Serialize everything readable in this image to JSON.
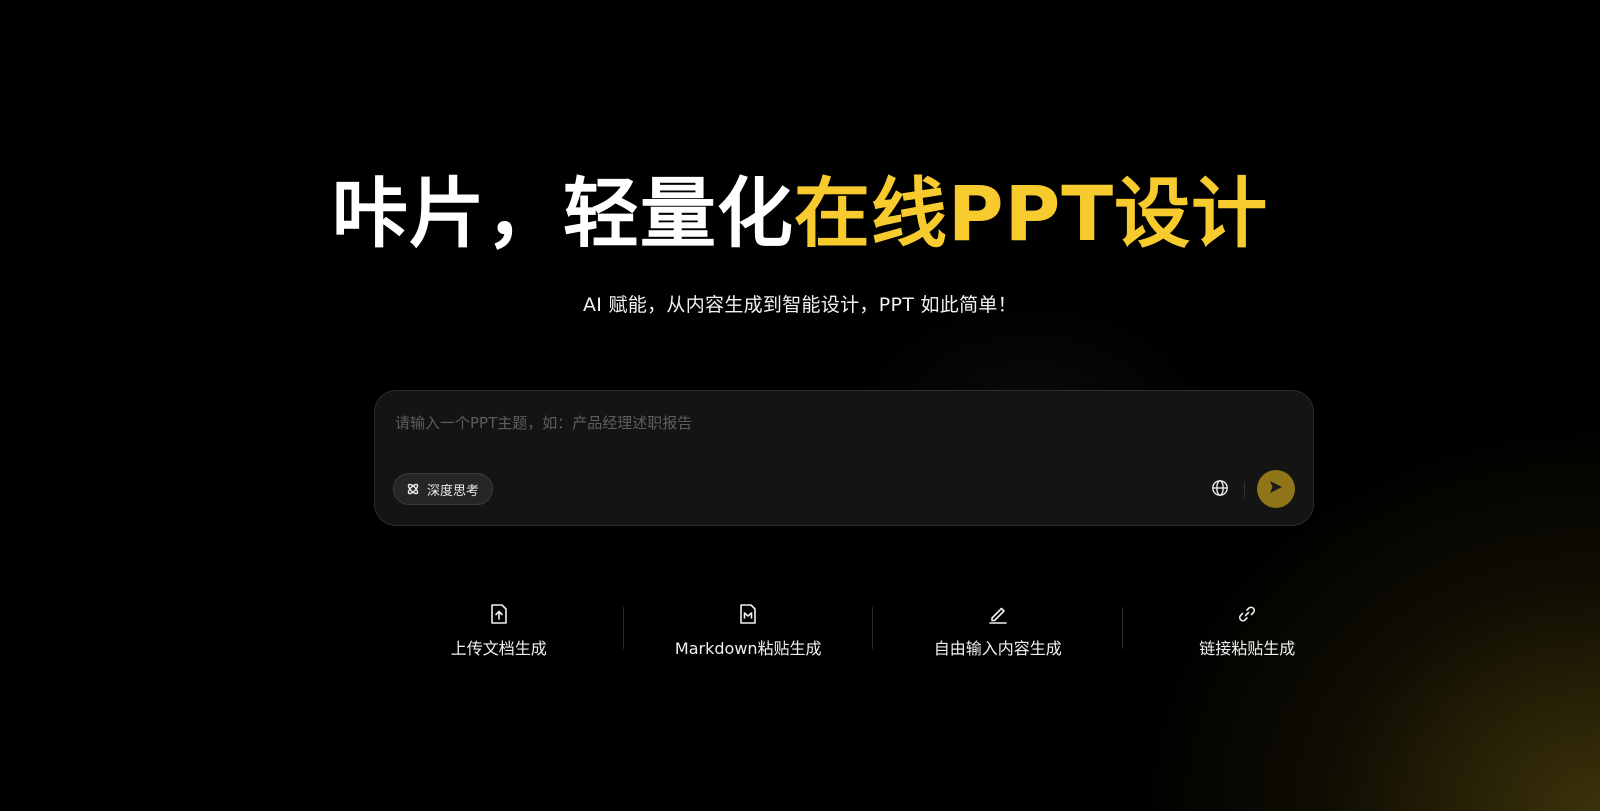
{
  "hero": {
    "title_white": "咔片，轻量化",
    "title_gold": "在线PPT设计",
    "subtitle": "AI 赋能，从内容生成到智能设计，PPT 如此简单！"
  },
  "prompt": {
    "placeholder": "请输入一个PPT主题，如：产品经理述职报告",
    "value": ""
  },
  "toolbar": {
    "deep_think_label": "深度思考",
    "globe_icon": "globe-icon",
    "send_icon": "send-icon"
  },
  "options": [
    {
      "label": "上传文档生成",
      "icon": "upload-file-icon"
    },
    {
      "label": "Markdown粘贴生成",
      "icon": "markdown-file-icon"
    },
    {
      "label": "自由输入内容生成",
      "icon": "pen-edit-icon"
    },
    {
      "label": "链接粘贴生成",
      "icon": "link-icon"
    }
  ],
  "colors": {
    "background": "#000000",
    "accent_gold": "#f7cb2d",
    "send_button": "#8f7517",
    "input_bg": "#141414"
  }
}
